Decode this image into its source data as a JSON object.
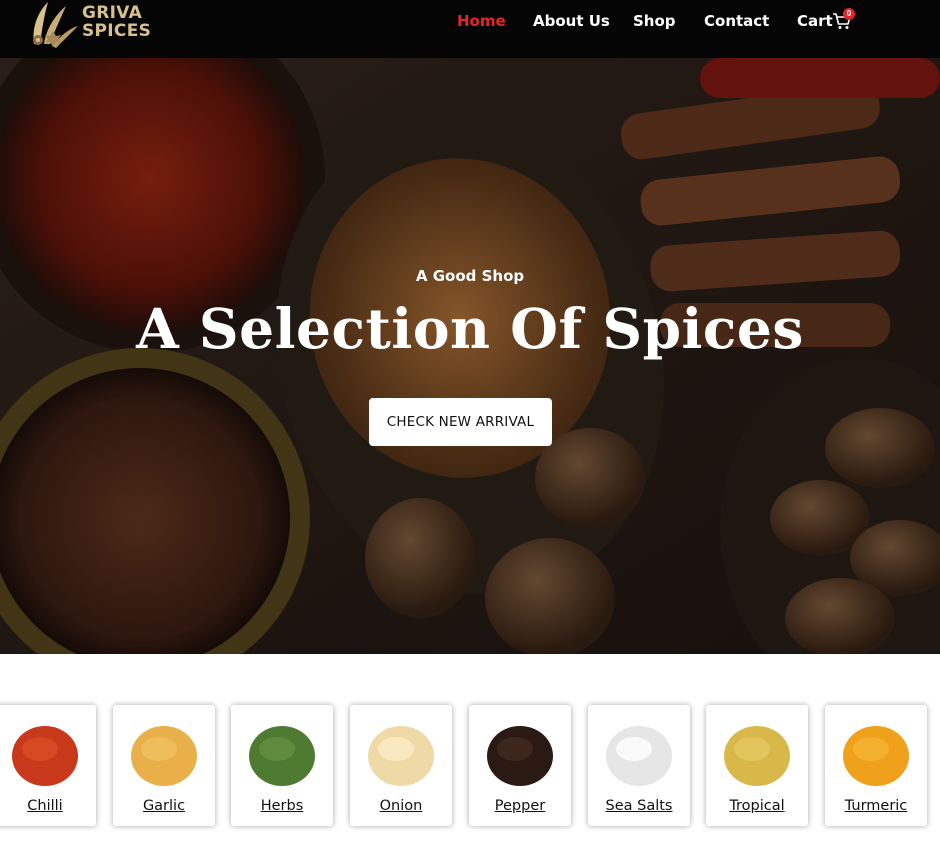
{
  "header": {
    "logo_line1": "GRIVA",
    "logo_line2": "SPICES",
    "nav": [
      {
        "label": "Home",
        "active": true
      },
      {
        "label": "About Us",
        "active": false
      },
      {
        "label": "Shop",
        "active": false
      },
      {
        "label": "Contact",
        "active": false
      },
      {
        "label": "Cart",
        "active": false
      }
    ],
    "cart_count": "0"
  },
  "hero": {
    "eyebrow": "A Good Shop",
    "title": "A Selection Of Spices",
    "button_label": "CHECK NEW ARRIVAL"
  },
  "categories": [
    {
      "label": "Chilli",
      "color": "#c8381a"
    },
    {
      "label": "Garlic",
      "color": "#e9b04a"
    },
    {
      "label": "Herbs",
      "color": "#4f7a32"
    },
    {
      "label": "Onion",
      "color": "#efd9a6"
    },
    {
      "label": "Pepper",
      "color": "#2b1a14"
    },
    {
      "label": "Sea Salts",
      "color": "#eeeeee"
    },
    {
      "label": "Tropical",
      "color": "#d9b84a"
    },
    {
      "label": "Turmeric",
      "color": "#f0a11c"
    }
  ],
  "colors": {
    "header_bg": "#050505",
    "accent": "#e3262c",
    "logo_gold": "#d8c08f"
  }
}
